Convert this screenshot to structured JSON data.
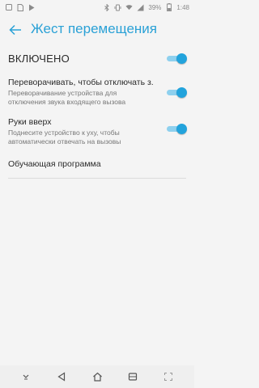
{
  "status_bar": {
    "battery_percent": "39%",
    "time": "1:48",
    "icons": [
      "notification-icon",
      "sim-icon",
      "play-store-icon",
      "bluetooth-icon",
      "vibrate-icon",
      "wifi-icon",
      "signal-icon",
      "battery-icon"
    ]
  },
  "header": {
    "title": "Жест перемещения",
    "back_icon": "arrow-left-icon"
  },
  "master": {
    "label": "ВКЛЮЧЕНО",
    "enabled": true
  },
  "settings": [
    {
      "title": "Переворачивать, чтобы отключать з...",
      "subtitle_line1": "Переворачивание устройства для",
      "subtitle_line2": "отключения звука входящего вызова",
      "enabled": true
    },
    {
      "title": "Руки вверх",
      "subtitle_line1": "Поднесите устройство к уху, чтобы",
      "subtitle_line2": "автоматически отвечать на вызовы",
      "enabled": true
    },
    {
      "title": "Обучающая программа"
    }
  ],
  "navbar": {
    "icons": [
      "chevron-down-icon",
      "back-triangle-icon",
      "home-icon",
      "recents-icon",
      "screenshot-icon"
    ]
  },
  "colors": {
    "accent": "#22a3dc",
    "accent_track": "#8ed0ee",
    "background": "#f4f4f4"
  }
}
